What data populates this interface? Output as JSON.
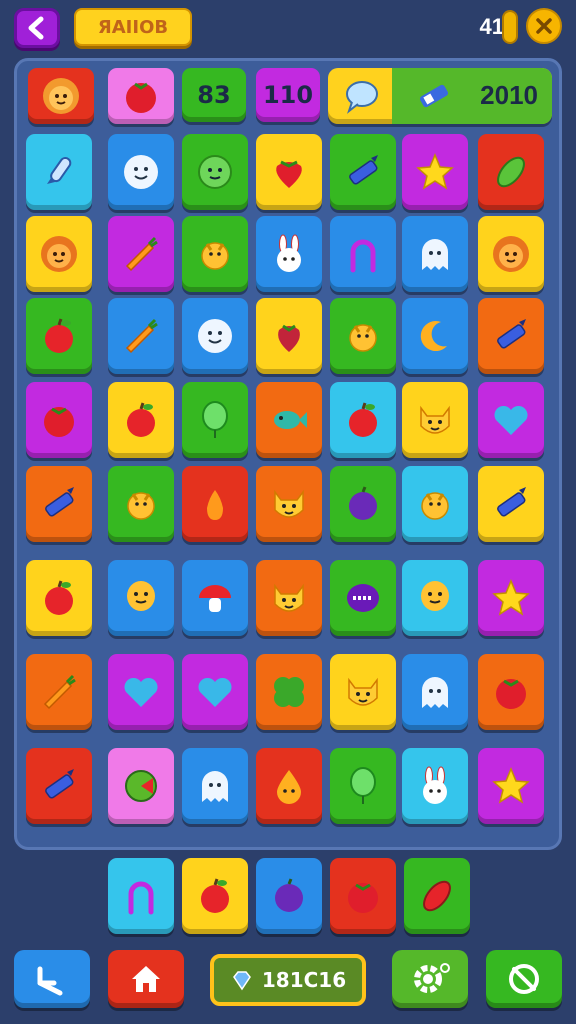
{
  "header": {
    "title_badge": "ЯAIIOB",
    "coin_count": "41"
  },
  "top_row": {
    "cells": [
      "83",
      "110"
    ],
    "score": "2010"
  },
  "footer": {
    "score_display": "181C16"
  },
  "colors": {
    "red": "#e4321e",
    "orange": "#f26a12",
    "yellow": "#ffd31c",
    "green": "#36b821",
    "blue": "#2a8de8",
    "cyan": "#35c5ec",
    "magenta": "#c22ae0",
    "pink": "#f07ae8"
  },
  "grid": [
    [
      [
        "cyan",
        "rocket-icon"
      ],
      [
        "blue",
        "smiley-face-icon"
      ],
      [
        "green",
        "green-face-icon"
      ],
      [
        "yellow",
        "strawberry-icon"
      ],
      [
        "green",
        "crayon-icon"
      ],
      [
        "magenta",
        "star-icon"
      ],
      [
        "red",
        "pickle-icon"
      ]
    ],
    [
      [
        "yellow",
        "lion-face-icon"
      ],
      [
        "magenta",
        "carrot-icon"
      ],
      [
        "green",
        "bird-icon"
      ],
      [
        "blue",
        "bunny-icon"
      ],
      [
        "blue",
        "horseshoe-icon"
      ],
      [
        "blue",
        "ghost-icon"
      ],
      [
        "yellow",
        "lion-face-icon"
      ]
    ],
    [
      [
        "green",
        "apple-icon"
      ],
      [
        "blue",
        "carrot-icon"
      ],
      [
        "blue",
        "smiley-face-icon"
      ],
      [
        "yellow",
        "berry-icon"
      ],
      [
        "green",
        "bird-icon"
      ],
      [
        "blue",
        "moon-icon"
      ],
      [
        "orange",
        "crayon-icon"
      ]
    ],
    [
      [
        "magenta",
        "tomato-icon"
      ],
      [
        "yellow",
        "apple-icon"
      ],
      [
        "green",
        "balloon-icon"
      ],
      [
        "orange",
        "fish-icon"
      ],
      [
        "cyan",
        "apple-icon"
      ],
      [
        "yellow",
        "cat-face-icon"
      ],
      [
        "magenta",
        "heart-icon"
      ]
    ],
    [
      [
        "orange",
        "crayon-icon"
      ],
      [
        "green",
        "bird-icon"
      ],
      [
        "red",
        "pear-icon"
      ],
      [
        "orange",
        "cat-face-icon"
      ],
      [
        "green",
        "plum-icon"
      ],
      [
        "cyan",
        "bird-icon"
      ],
      [
        "yellow",
        "crayon-icon"
      ]
    ],
    [
      [
        "yellow",
        "apple-icon"
      ],
      [
        "blue",
        "balloon-face-icon"
      ],
      [
        "blue",
        "mushroom-icon"
      ],
      [
        "orange",
        "cat-face-icon"
      ],
      [
        "green",
        "monster-icon"
      ],
      [
        "cyan",
        "balloon-face-icon"
      ],
      [
        "magenta",
        "star-icon"
      ]
    ],
    [
      [
        "orange",
        "carrot-icon"
      ],
      [
        "magenta",
        "heart-icon"
      ],
      [
        "magenta",
        "heart-icon"
      ],
      [
        "orange",
        "clover-icon"
      ],
      [
        "yellow",
        "cat-face-icon"
      ],
      [
        "blue",
        "ghost-icon"
      ],
      [
        "orange",
        "tomato-icon"
      ]
    ],
    [
      [
        "red",
        "crayon-icon"
      ],
      [
        "pink",
        "melon-icon"
      ],
      [
        "blue",
        "ghost-icon"
      ],
      [
        "red",
        "drop-face-icon"
      ],
      [
        "green",
        "balloon-icon"
      ],
      [
        "cyan",
        "bunny-icon"
      ],
      [
        "magenta",
        "star-icon"
      ]
    ]
  ],
  "tray": [
    [
      "cyan",
      "horseshoe-icon"
    ],
    [
      "yellow",
      "apple-icon"
    ],
    [
      "blue",
      "plum-icon"
    ],
    [
      "red",
      "tomato-icon"
    ],
    [
      "green",
      "leaf-icon"
    ]
  ]
}
